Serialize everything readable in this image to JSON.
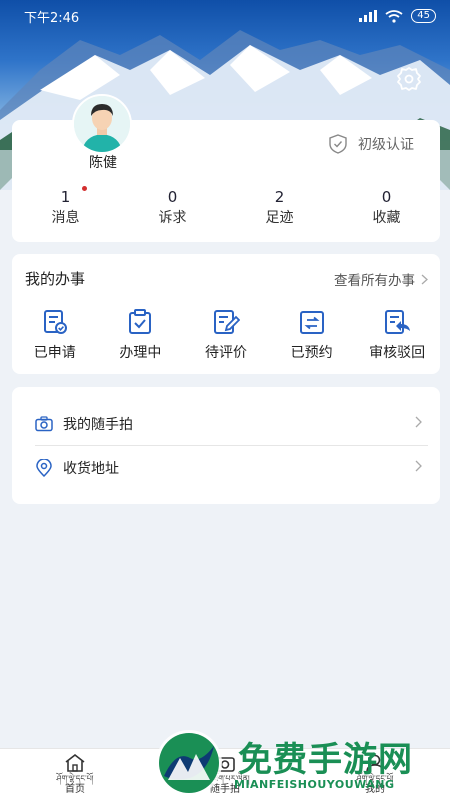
{
  "status_bar": {
    "time": "下午2:46",
    "battery": "45"
  },
  "profile": {
    "name": "陈健",
    "verification": "初级认证",
    "stats": [
      {
        "count": "1",
        "label": "消息",
        "has_dot": true
      },
      {
        "count": "0",
        "label": "诉求"
      },
      {
        "count": "2",
        "label": "足迹"
      },
      {
        "count": "0",
        "label": "收藏"
      }
    ]
  },
  "affairs": {
    "title": "我的办事",
    "more": "查看所有办事",
    "items": [
      {
        "label": "已申请",
        "icon": "applied-icon"
      },
      {
        "label": "办理中",
        "icon": "processing-icon"
      },
      {
        "label": "待评价",
        "icon": "to-review-icon"
      },
      {
        "label": "已预约",
        "icon": "booked-icon"
      },
      {
        "label": "审核驳回",
        "icon": "rejected-icon"
      }
    ]
  },
  "list": [
    {
      "label": "我的随手拍",
      "icon": "camera-icon"
    },
    {
      "label": "收货地址",
      "icon": "location-pin-icon"
    }
  ],
  "bottom_nav": [
    {
      "tibetan": "ཤོག་ལྷེ་དང་པོ།",
      "label": "首页",
      "icon": "home-icon"
    },
    {
      "tibetan": "ལག་ཐོག་པར་ལེན།",
      "label": "随手拍",
      "icon": "camera-icon"
    },
    {
      "tibetan": "ཤོག་ལྷེ་དང་པོ།",
      "label": "我的",
      "icon": "profile-icon"
    }
  ],
  "watermark": {
    "title": "免费手游网",
    "subtitle": "MIANFEISHOUYOUWANG"
  },
  "colors": {
    "accent": "#2a63c4",
    "background": "#eef2f7",
    "watermark": "#1a8f55"
  }
}
